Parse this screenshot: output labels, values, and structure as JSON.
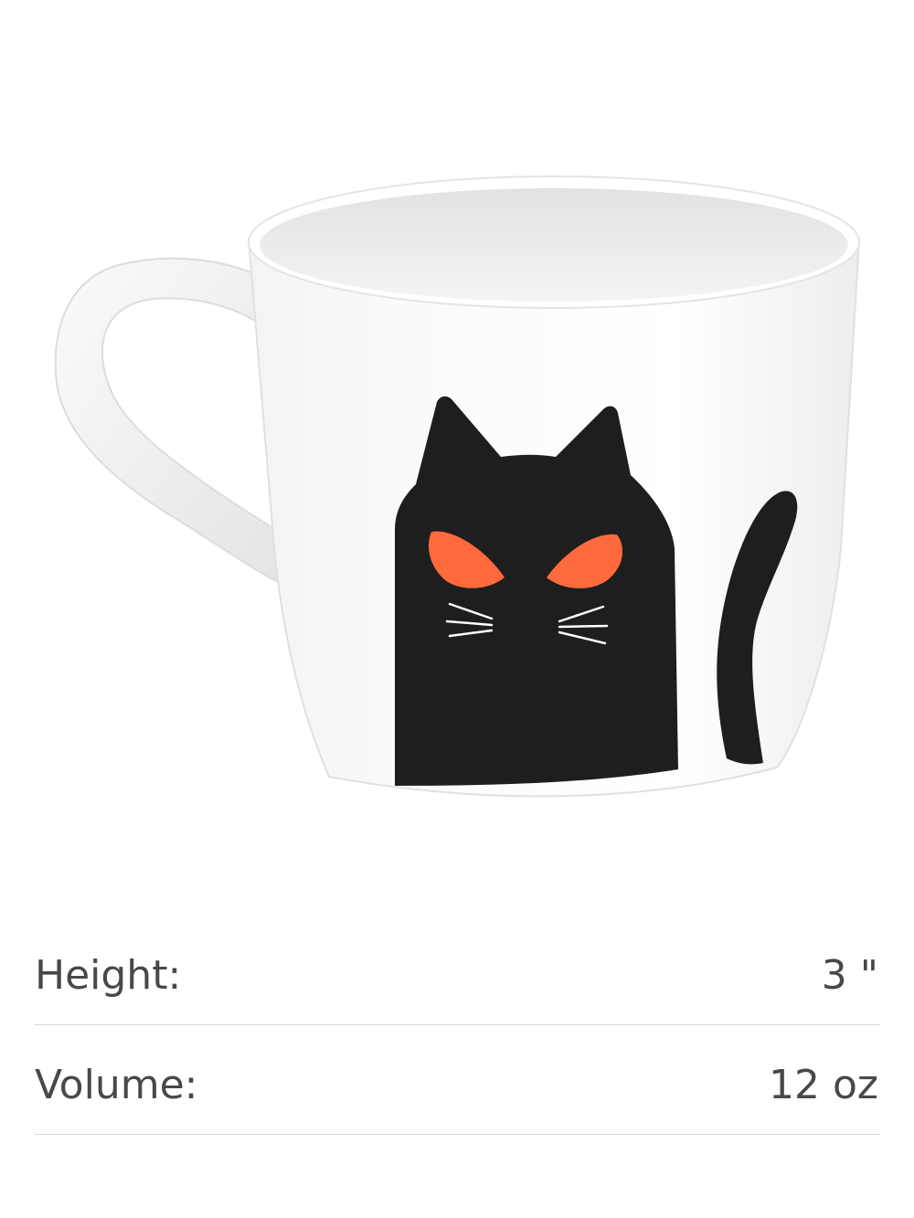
{
  "product": {
    "image_name": "black cat mug"
  },
  "dimensions": [
    {
      "label": "Height:",
      "value": "3 \""
    },
    {
      "label": "Volume:",
      "value": "12 oz"
    }
  ],
  "colors": {
    "background": "#ffffff",
    "text": "#484848",
    "divider": "#d6d6d6",
    "cat": "#1e1e1e",
    "cat_eyes": "#ff6a3d"
  }
}
